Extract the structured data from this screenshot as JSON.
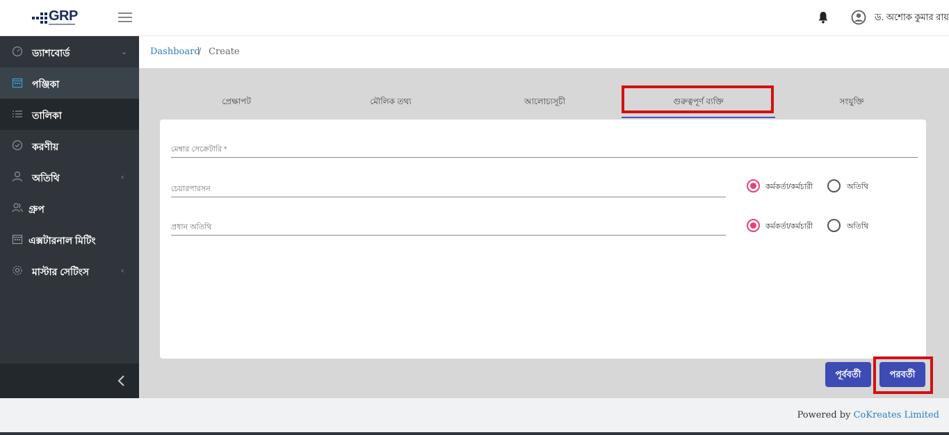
{
  "app": {
    "logo_text": "GRP",
    "user_name": "ড. অশোক কুমার রায়"
  },
  "sidebar": {
    "items": [
      {
        "label": "ড্যাশবোর্ড",
        "icon": "speedometer-icon",
        "chevron": "down"
      },
      {
        "label": "পঞ্জিকা",
        "icon": "calendar-icon",
        "active": true
      },
      {
        "label": "তালিকা",
        "icon": "list-icon"
      },
      {
        "label": "করণীয়",
        "icon": "check-circle-icon"
      },
      {
        "label": "অতিথি",
        "icon": "user-icon",
        "chevron": "left"
      },
      {
        "label": "গ্রুপ",
        "icon": "users-icon"
      },
      {
        "label": "এক্সটারনাল মিটিং",
        "icon": "calendar-grid-icon"
      },
      {
        "label": "মাস্টার সেটিংস",
        "icon": "gear-icon",
        "chevron": "left"
      }
    ]
  },
  "breadcrumb": {
    "home": "Dashboard",
    "separator": "/",
    "current": "Create"
  },
  "tabs": [
    {
      "label": "প্রেক্ষাপট"
    },
    {
      "label": "মৌলিক তথ্য"
    },
    {
      "label": "আলোচ্যসূচী"
    },
    {
      "label": "গুরুত্বপূর্ণ ব্যক্তি",
      "active": true
    },
    {
      "label": "সংযুক্তি"
    }
  ],
  "form": {
    "member_secretary_label": "মেম্বার সেক্রেটারি *",
    "chairperson_label": "চেয়ারপারসন",
    "chief_guest_label": "প্রধান অতিথি",
    "radio_officer_label": "কর্মকর্তা/কর্মচারী",
    "radio_guest_label": "অতিথি"
  },
  "buttons": {
    "previous": "পূর্ববর্তী",
    "next": "পরবর্তী"
  },
  "footer": {
    "powered_by": "Powered by",
    "company": "CoKreates Limited"
  },
  "colors": {
    "sidebar_bg": "#2f353a",
    "accent": "#3d4bb5",
    "radio_selected": "#e9407a",
    "highlight_box": "#d31010",
    "link": "#2e7fbf"
  }
}
